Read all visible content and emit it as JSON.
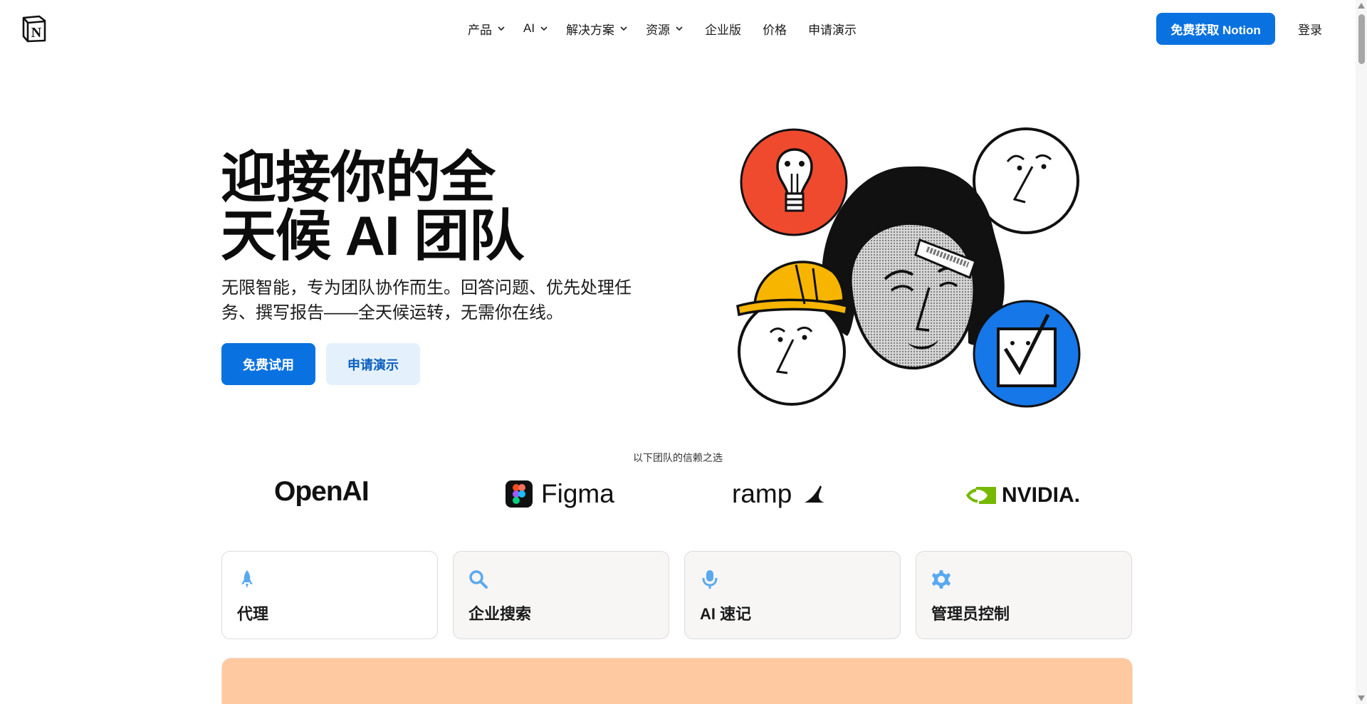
{
  "header": {
    "logo_name": "notion-logo",
    "nav": [
      {
        "label": "产品",
        "has_dropdown": true
      },
      {
        "label": "AI",
        "has_dropdown": true
      },
      {
        "label": "解决方案",
        "has_dropdown": true
      },
      {
        "label": "资源",
        "has_dropdown": true
      },
      {
        "label": "企业版",
        "has_dropdown": false
      },
      {
        "label": "价格",
        "has_dropdown": false
      },
      {
        "label": "申请演示",
        "has_dropdown": false
      }
    ],
    "cta_label": "免费获取 Notion",
    "login_label": "登录"
  },
  "hero": {
    "title_line1": "迎接你的全",
    "title_line2": "天候 AI 团队",
    "subtitle": "无限智能，专为团队协作而生。回答问题、优先处理任务、撰写报告——全天候运转，无需你在线。",
    "primary_button": "免费试用",
    "secondary_button": "申请演示"
  },
  "trusted": {
    "label": "以下团队的信赖之选",
    "brands": [
      "OpenAI",
      "Figma",
      "ramp",
      "NVIDIA."
    ]
  },
  "features": [
    {
      "label": "代理",
      "icon": "rocket-icon",
      "active": true
    },
    {
      "label": "企业搜索",
      "icon": "search-icon",
      "active": false
    },
    {
      "label": "AI 速记",
      "icon": "microphone-icon",
      "active": false
    },
    {
      "label": "管理员控制",
      "icon": "gear-icon",
      "active": false
    }
  ],
  "colors": {
    "primary": "#0a72e0",
    "secondary_bg": "#e4f1fd",
    "peach": "#fec9a0",
    "icon_blue": "#5aa9ee",
    "art_red": "#f04a2e",
    "art_yellow": "#f7b500",
    "art_blue": "#1677e8"
  }
}
